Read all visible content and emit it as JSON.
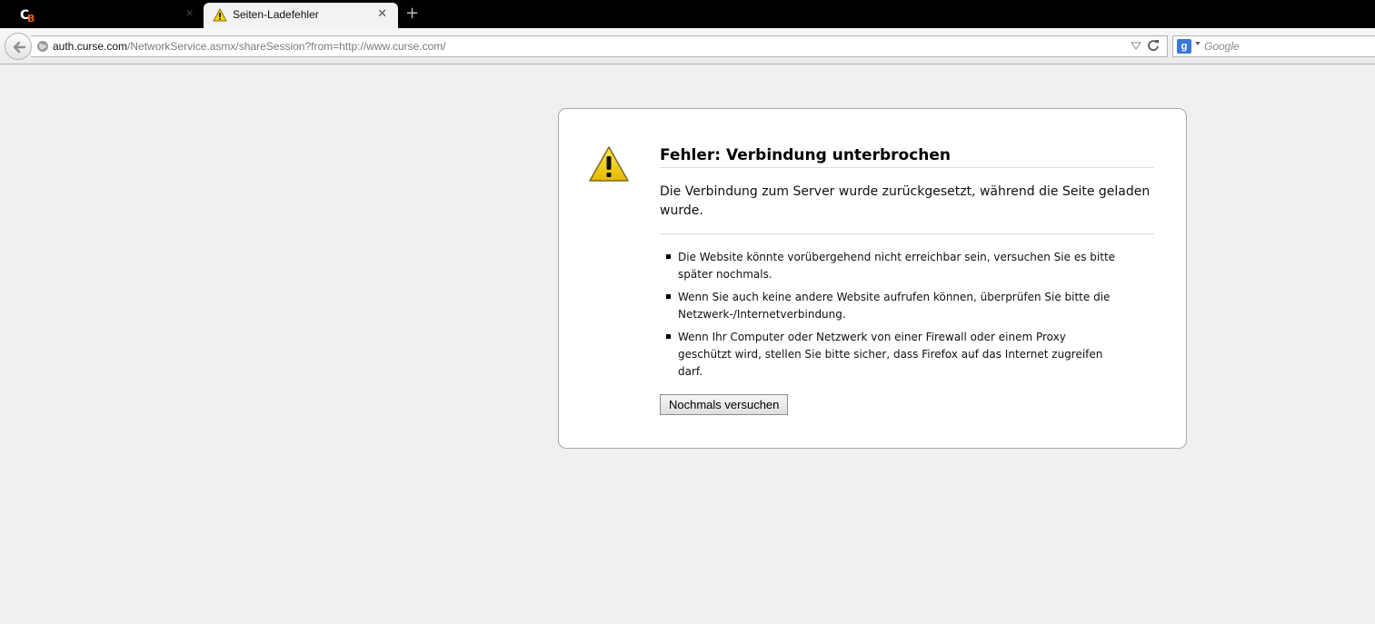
{
  "tabs": {
    "active_title": "Seiten-Ladefehler"
  },
  "navbar": {
    "url_host": "auth.curse.com",
    "url_path": "/NetworkService.asmx/shareSession?from=http://www.curse.com/",
    "search_placeholder": "Google"
  },
  "error": {
    "title": "Fehler: Verbindung unterbrochen",
    "description": "Die Verbindung zum Server wurde zurückgesetzt, während die Seite geladen wurde.",
    "suggestions": [
      "Die Website könnte vorübergehend nicht erreichbar sein, versuchen Sie es bitte später nochmals.",
      "Wenn Sie auch keine andere Website aufrufen können, überprüfen Sie bitte die Netzwerk-/Internetverbindung.",
      "Wenn Ihr Computer oder Netzwerk von einer Firewall oder einem Proxy geschützt wird, stellen Sie bitte sicher, dass Firefox auf das Internet zugreifen darf."
    ],
    "retry_label": "Nochmals versuchen"
  },
  "colors": {
    "tabstrip_bg": "#000000",
    "page_bg": "#f0f0f0",
    "warning_yellow": "#f5d100",
    "logo_orange": "#e8641b"
  }
}
